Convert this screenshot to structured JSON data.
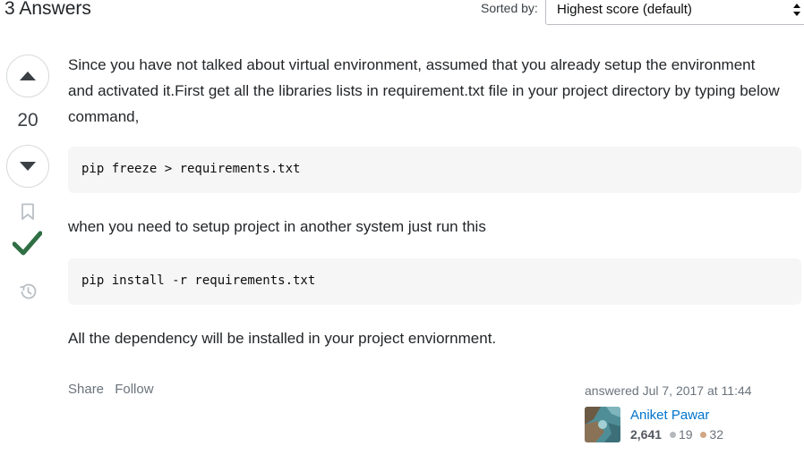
{
  "header": {
    "answers_count": "3 Answers",
    "sort_label": "Sorted by:",
    "sort_value": "Highest score (default)"
  },
  "vote": {
    "score": "20"
  },
  "answer": {
    "p1": "Since you have not talked about virtual environment, assumed that you already setup the environment and activated it.First get all the libraries lists in requirement.txt file in your project directory by typing below command,",
    "code1": "pip freeze > requirements.txt",
    "p2": "when you need to setup project in another system just run this",
    "code2": "pip install -r requirements.txt",
    "p3": "All the dependency will be installed in your project enviornment."
  },
  "actions": {
    "share": "Share",
    "follow": "Follow"
  },
  "user": {
    "answered": "answered Jul 7, 2017 at 11:44",
    "name": "Aniket Pawar",
    "reputation": "2,641",
    "silver": "19",
    "bronze": "32"
  },
  "colors": {
    "accepted": "#2f6f44",
    "link": "#0074cc"
  }
}
